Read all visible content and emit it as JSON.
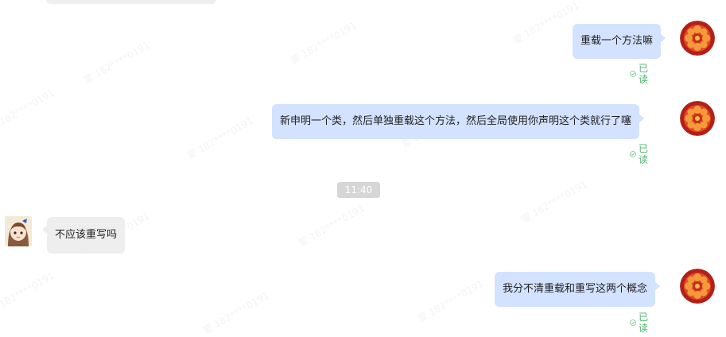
{
  "messages": [
    {
      "side": "right",
      "text": "重载一个方法嘛",
      "status": "已读"
    },
    {
      "side": "right",
      "text": "新申明一个类，然后单独重载这个方法，然后全局使用你声明这个类就行了噻",
      "status": "已读"
    },
    {
      "side": "left",
      "text": "不应该重写吗"
    },
    {
      "side": "right",
      "text": "我分不清重载和重写这两个概念",
      "status": "已读"
    }
  ],
  "time_divider": "11:40",
  "icons": {
    "read_check": "check-circle-icon",
    "self_avatar": "orange-flower-avatar",
    "contact_avatar": "anime-girl-avatar"
  },
  "colors": {
    "sent_bubble": "#d3e2ff",
    "received_bubble": "#eeeeee",
    "read_status": "#4cb36b",
    "time_badge": "#d6d6d6"
  }
}
